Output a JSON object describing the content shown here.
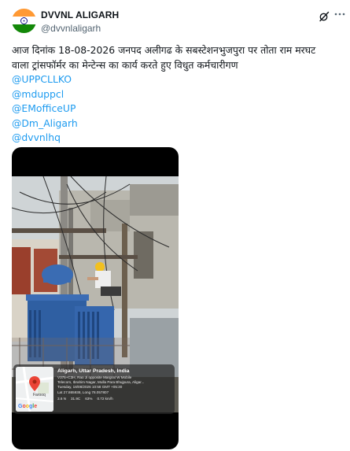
{
  "account": {
    "name": "DVVNL ALIGARH",
    "handle": "@dvvnlaligarh"
  },
  "icons": {
    "avatar": "india-flag-avatar",
    "grok": "grok-icon",
    "more": "more-options-icon",
    "map_pin": "map-pin-icon",
    "weather": "weather-icon"
  },
  "colors": {
    "accent": "#1d9bf0",
    "text": "#0f1419",
    "secondary": "#536471"
  },
  "tweet": {
    "line1": "आज दिनांक 18-08-2026 जनपद अलीगढ के सबस्टेशनभुजपुरा  पर तोता राम मरघट",
    "line2": "वाला ट्रांसफॉर्मर का मेन्टेन्स का कार्य करते हुए विधुत कर्मचारीगण",
    "mentions": [
      "@UPPCLLKO",
      "@mduppcl",
      "@EMofficeUP",
      "@Dm_Aligarh",
      "@dvvnlhq"
    ]
  },
  "geotag": {
    "map_place": "Farooq",
    "map_logo": "Google",
    "title": "Aligarh, Uttar Pradesh, India",
    "address1": "V375+C3H, Rao Ji opposite Margrat W Mobile",
    "address2": "Telecom, Ibrahim Nagar, Mulla Para Bhujpura, Aligar...",
    "datetime": "Tuesday, 18/08/2026 10:58 GMT +05:30",
    "coords": "Lat 27.865938, Long 78.057807",
    "wind": "3.6 N",
    "temp": "31.9C",
    "humidity": "63%",
    "pressure": "0.72 km/h"
  }
}
